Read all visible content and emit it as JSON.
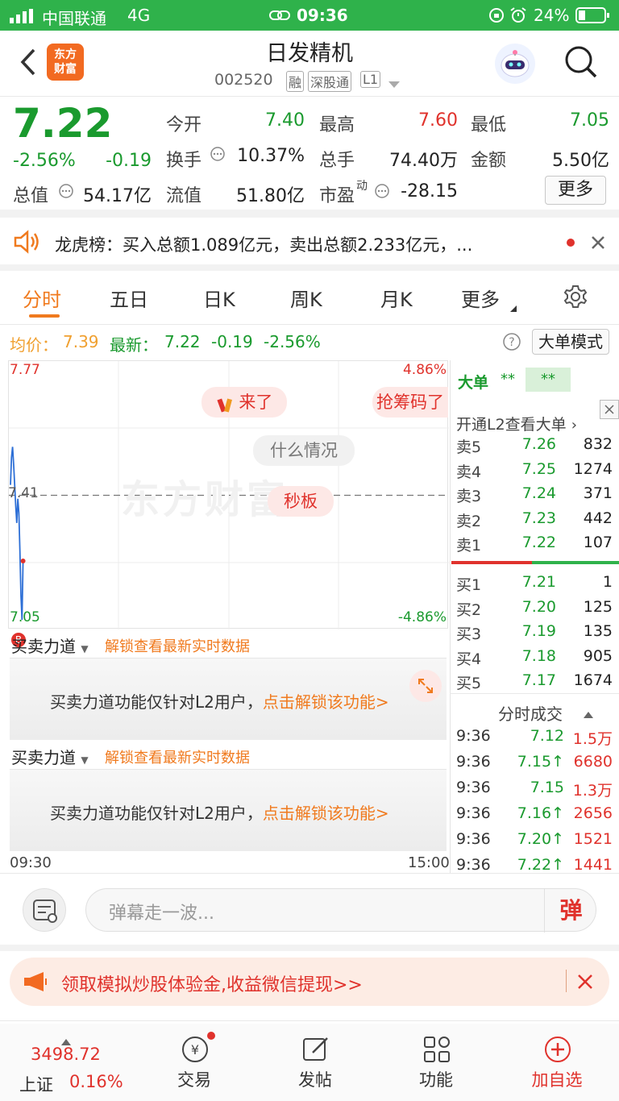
{
  "status_bar": {
    "carrier": "中国联通",
    "network": "4G",
    "time": "09:36",
    "battery": "24%"
  },
  "header": {
    "title": "日发精机",
    "code": "002520",
    "tags": [
      "融",
      "深股通",
      "L1"
    ],
    "logo_text": "东方\n财富"
  },
  "quote": {
    "price": "7.22",
    "change_pct": "-2.56%",
    "change": "-0.19",
    "open_label": "今开",
    "open": "7.40",
    "high_label": "最高",
    "high": "7.60",
    "low_label": "最低",
    "low": "7.05",
    "turnover_label": "换手",
    "turnover": "10.37%",
    "volume_label": "总手",
    "volume": "74.40万",
    "amount_label": "金额",
    "amount": "5.50亿",
    "mcap_label": "总值",
    "mcap": "54.17亿",
    "float_label": "流值",
    "float": "51.80亿",
    "pe_label": "市盈",
    "pe_sup": "动",
    "pe": "-28.15",
    "more_button": "更多"
  },
  "notice": {
    "text": "龙虎榜：买入总额1.089亿元，卖出总额2.233亿元，..."
  },
  "tabs": [
    "分时",
    "五日",
    "日K",
    "周K",
    "月K",
    "更多"
  ],
  "chart_info": {
    "avg_label": "均价：",
    "avg": "7.39",
    "latest_label": "最新：",
    "latest": "7.22",
    "change": "-0.19",
    "change_pct": "-2.56%",
    "mode_button": "大单模式"
  },
  "chart_data": {
    "type": "line",
    "x_start_label": "09:30",
    "x_end_label": "15:00",
    "y_top_label": "7.77",
    "y_bottom_label": "7.05",
    "y_mid_label": "7.41",
    "pct_top_label": "4.86%",
    "pct_bottom_label": "-4.86%",
    "ylim": [
      7.05,
      7.77
    ],
    "series": [
      {
        "values": [
          7.44,
          7.52,
          7.55,
          7.5,
          7.44,
          7.38,
          7.33,
          7.4,
          7.36,
          7.25,
          7.12,
          7.05,
          7.22
        ]
      }
    ]
  },
  "chart_overlays": {
    "bubble1": "来了",
    "bubble2": "抢筹码了",
    "bubble3": "什么情况",
    "bubble4": "秒板",
    "watermark": "东方财富"
  },
  "power_panels": [
    {
      "dropdown": "买卖力道",
      "unlock_link": "解锁查看最新实时数据",
      "msg": "买卖力道功能仅针对L2用户，",
      "msg_link": "点击解锁该功能>"
    },
    {
      "dropdown": "买卖力道",
      "unlock_link": "解锁查看最新实时数据",
      "msg": "买卖力道功能仅针对L2用户，",
      "msg_link": "点击解锁该功能>"
    }
  ],
  "orderbook": {
    "big_label": "大单",
    "big_val1": "**",
    "big_val2": "**",
    "l2_link": "开通L2查看大单",
    "asks": [
      {
        "label": "卖5",
        "price": "7.26",
        "vol": "832"
      },
      {
        "label": "卖4",
        "price": "7.25",
        "vol": "1274"
      },
      {
        "label": "卖3",
        "price": "7.24",
        "vol": "371"
      },
      {
        "label": "卖2",
        "price": "7.23",
        "vol": "442"
      },
      {
        "label": "卖1",
        "price": "7.22",
        "vol": "107"
      }
    ],
    "bids": [
      {
        "label": "买1",
        "price": "7.21",
        "vol": "1"
      },
      {
        "label": "买2",
        "price": "7.20",
        "vol": "125"
      },
      {
        "label": "买3",
        "price": "7.19",
        "vol": "135"
      },
      {
        "label": "买4",
        "price": "7.18",
        "vol": "905"
      },
      {
        "label": "买5",
        "price": "7.17",
        "vol": "1674"
      }
    ]
  },
  "ticks": {
    "title": "分时成交",
    "rows": [
      {
        "time": "9:36",
        "price": "7.12",
        "vol": "1.5万"
      },
      {
        "time": "9:36",
        "price": "7.15↑",
        "vol": "6680"
      },
      {
        "time": "9:36",
        "price": "7.15",
        "vol": "1.3万"
      },
      {
        "time": "9:36",
        "price": "7.16↑",
        "vol": "2656"
      },
      {
        "time": "9:36",
        "price": "7.20↑",
        "vol": "1521"
      },
      {
        "time": "9:36",
        "price": "7.22↑",
        "vol": "1441"
      }
    ]
  },
  "comment": {
    "placeholder": "弹幕走一波...",
    "send_label": "弹"
  },
  "promo": {
    "text": "领取模拟炒股体验金,收益微信提现>>"
  },
  "bottom_nav": {
    "index_value": "3498.72",
    "index_name": "上证",
    "index_change": "0.16%",
    "items": [
      "交易",
      "发帖",
      "功能",
      "加自选"
    ]
  },
  "colors": {
    "up": "#e0322c",
    "down": "#1a9a2e",
    "brand": "#2fb24b",
    "accent": "#f07a1e"
  }
}
